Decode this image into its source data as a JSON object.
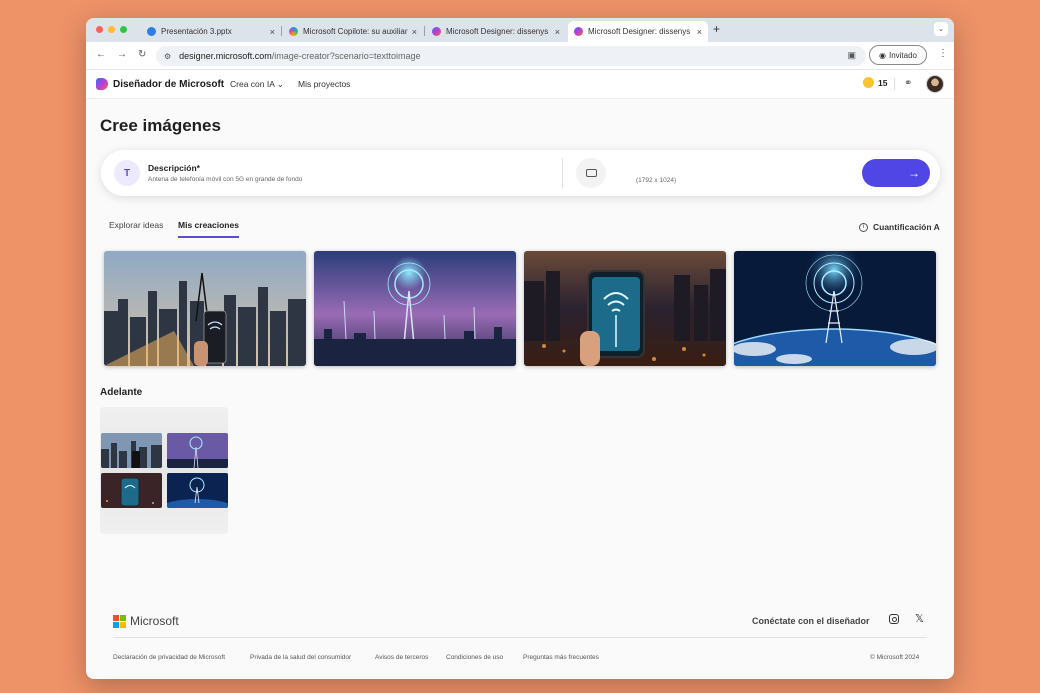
{
  "browser": {
    "tabs": [
      {
        "title": "Presentación 3.pptx",
        "close": "×"
      },
      {
        "title": "Microsoft Copilote: su auxiliar",
        "close": "×"
      },
      {
        "title": "Microsoft Designer: dissenys",
        "close": "×"
      },
      {
        "title": "Microsoft Designer: dissenys",
        "close": "×"
      }
    ],
    "new_tab": "+",
    "tab_menu": "⌄",
    "url_host": "designer.microsoft.com",
    "url_path": "/image-creator?scenario=texttoimage",
    "profile_label": "Invitado",
    "back_icon": "←",
    "forward_icon": "→",
    "reload_icon": "↻",
    "menu_icon": "⋮"
  },
  "header": {
    "brand": "Diseñador de Microsoft",
    "nav": [
      "Crea con IA",
      "Mis proyectos"
    ],
    "chevron": "⌄",
    "coins": "15"
  },
  "main": {
    "title": "Cree imágenes",
    "prompt": {
      "label": "Descripción*",
      "value": "Antena de telefonía móvil con 5G en grande de fondo",
      "size": "(1792 x 1024)",
      "submit_icon": "→"
    },
    "tabs": [
      "Explorar ideas",
      "Mis creaciones"
    ],
    "quantification": "Cuantificación A",
    "section_title": "Adelante"
  },
  "footer": {
    "brand": "Microsoft",
    "connect": "Conéctate con el diseñador",
    "links": [
      "Declaración de privacidad de Microsoft",
      "Privada de la salud del consumidor",
      "Avisos de terceros",
      "Condiciones de uso",
      "Preguntas más frecuentes"
    ],
    "copyright": "© Microsoft 2024",
    "x_icon": "𝕏"
  },
  "colors": {
    "background": "#EE9268",
    "accent": "#4F46E5",
    "coin": "#F8C531"
  }
}
